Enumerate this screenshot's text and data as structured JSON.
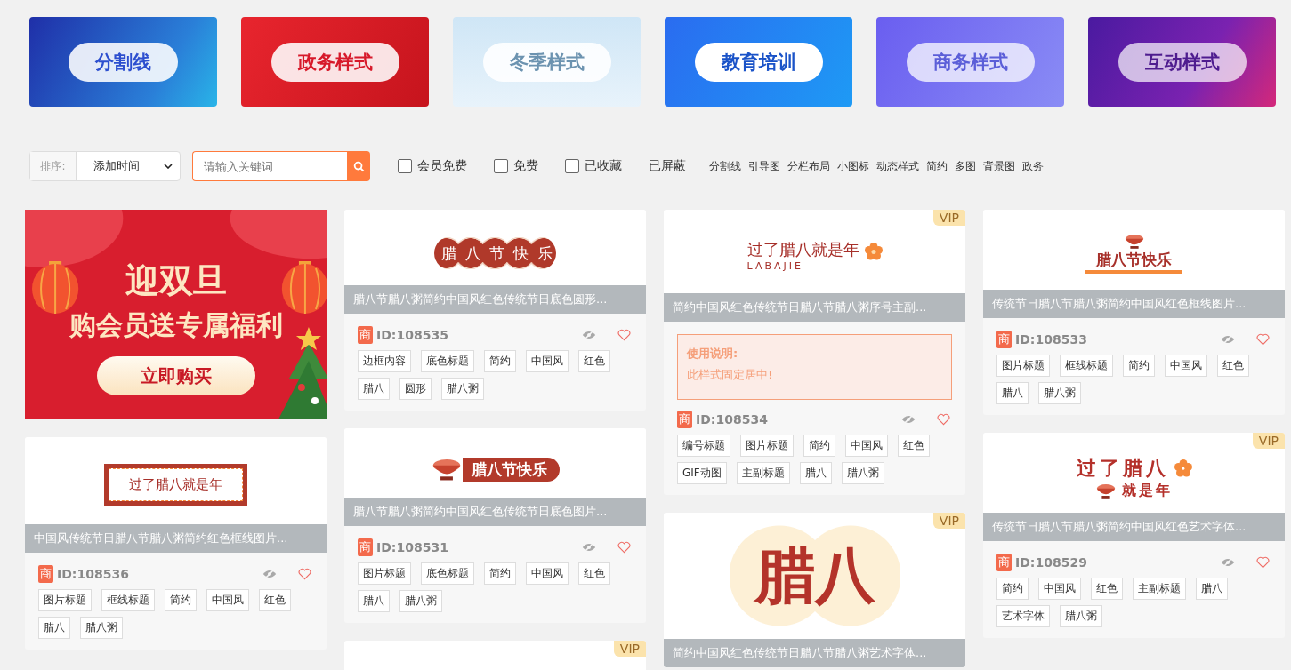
{
  "categories": [
    {
      "label": "分割线",
      "kind": "blue"
    },
    {
      "label": "政务样式",
      "kind": "red"
    },
    {
      "label": "冬季样式",
      "kind": "winter"
    },
    {
      "label": "教育培训",
      "kind": "sky"
    },
    {
      "label": "商务样式",
      "kind": "violet"
    },
    {
      "label": "互动样式",
      "kind": "purple"
    }
  ],
  "filters": {
    "sort_label": "排序:",
    "sort_value": "添加时间",
    "search_placeholder": "请输入关键词",
    "checkboxes": [
      {
        "label": "会员免费",
        "checked": false
      },
      {
        "label": "免费",
        "checked": false
      },
      {
        "label": "已收藏",
        "checked": false
      }
    ],
    "blocked_label": "已屏蔽",
    "keywords": [
      "分割线",
      "引导图",
      "分栏布局",
      "小图标",
      "动态样式",
      "简约",
      "多图",
      "背景图",
      "政务"
    ]
  },
  "columns": [
    [
      {
        "kind": "promo",
        "headline": "迎双旦",
        "subline": "购会员送专属福利",
        "button": "立即购买"
      },
      {
        "kind": "card",
        "preview": {
          "kind": "frame",
          "text": "过了腊八就是年"
        },
        "title": "中国风传统节日腊八节腊八粥简约红色框线图片...",
        "badge": "商",
        "id": "ID:108536",
        "liked": false,
        "tags": [
          "图片标题",
          "框线标题",
          "简约",
          "中国风",
          "红色",
          "腊八",
          "腊八粥"
        ]
      }
    ],
    [
      {
        "kind": "card",
        "preview": {
          "kind": "circles",
          "text": "腊八节快乐"
        },
        "title": "腊八节腊八粥简约中国风红色传统节日底色圆形...",
        "badge": "商",
        "id": "ID:108535",
        "liked": false,
        "tags": [
          "边框内容",
          "底色标题",
          "简约",
          "中国风",
          "红色",
          "腊八",
          "圆形",
          "腊八粥"
        ]
      },
      {
        "kind": "card",
        "preview": {
          "kind": "pill",
          "text": "腊八节快乐"
        },
        "title": "腊八节腊八粥简约中国风红色传统节日底色图片...",
        "badge": "商",
        "id": "ID:108531",
        "liked": false,
        "tags": [
          "图片标题",
          "底色标题",
          "简约",
          "中国风",
          "红色",
          "腊八",
          "腊八粥"
        ]
      },
      {
        "kind": "stub",
        "vip": "VIP"
      }
    ],
    [
      {
        "kind": "card",
        "vip": "VIP",
        "preview": {
          "kind": "logo",
          "text": "过了腊八就是年",
          "sub": "LABAJIE"
        },
        "title": "简约中国风红色传统节日腊八节腊八粥序号主副...",
        "note": {
          "heading": "使用说明:",
          "text": "此样式固定居中!"
        },
        "badge": "商",
        "id": "ID:108534",
        "liked": false,
        "tags": [
          "编号标题",
          "图片标题",
          "简约",
          "中国风",
          "红色",
          "GIF动图",
          "主副标题",
          "腊八",
          "腊八粥"
        ]
      },
      {
        "kind": "card",
        "vip": "VIP",
        "preview": {
          "kind": "big",
          "text": "腊八"
        },
        "title": "简约中国风红色传统节日腊八节腊八粥艺术字体..."
      }
    ],
    [
      {
        "kind": "card",
        "preview": {
          "kind": "underline",
          "text": "腊八节快乐"
        },
        "title": "传统节日腊八节腊八粥简约中国风红色框线图片...",
        "badge": "商",
        "id": "ID:108533",
        "liked": false,
        "tags": [
          "图片标题",
          "框线标题",
          "简约",
          "中国风",
          "红色",
          "腊八",
          "腊八粥"
        ]
      },
      {
        "kind": "card",
        "vip": "VIP",
        "preview": {
          "kind": "calligraphy",
          "text": "过了腊八",
          "sub": "就是年"
        },
        "title": "传统节日腊八节腊八粥简约中国风红色艺术字体...",
        "badge": "商",
        "id": "ID:108529",
        "liked": false,
        "tags": [
          "简约",
          "中国风",
          "红色",
          "主副标题",
          "腊八",
          "艺术字体",
          "腊八粥"
        ]
      }
    ]
  ]
}
